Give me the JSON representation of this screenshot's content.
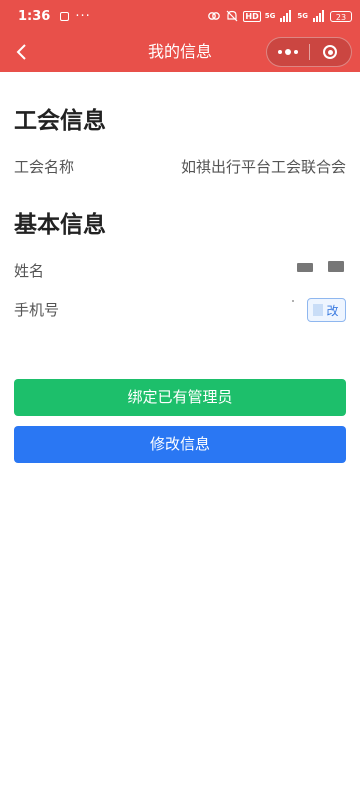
{
  "status_bar": {
    "time": "1:36",
    "net1": "5G",
    "net2": "5G",
    "hd": "HD",
    "battery": "23"
  },
  "nav": {
    "title": "我的信息"
  },
  "union_section": {
    "title": "工会信息",
    "name_label": "工会名称",
    "name_value": "如祺出行平台工会联合会"
  },
  "basic_section": {
    "title": "基本信息",
    "name_label": "姓名",
    "phone_label": "手机号",
    "phone_edit_label": "改"
  },
  "buttons": {
    "bind_admin": "绑定已有管理员",
    "edit_info": "修改信息"
  },
  "colors": {
    "header_bg": "#e8504a",
    "green_button": "#1dbf6b",
    "blue_button": "#2a77f3"
  }
}
